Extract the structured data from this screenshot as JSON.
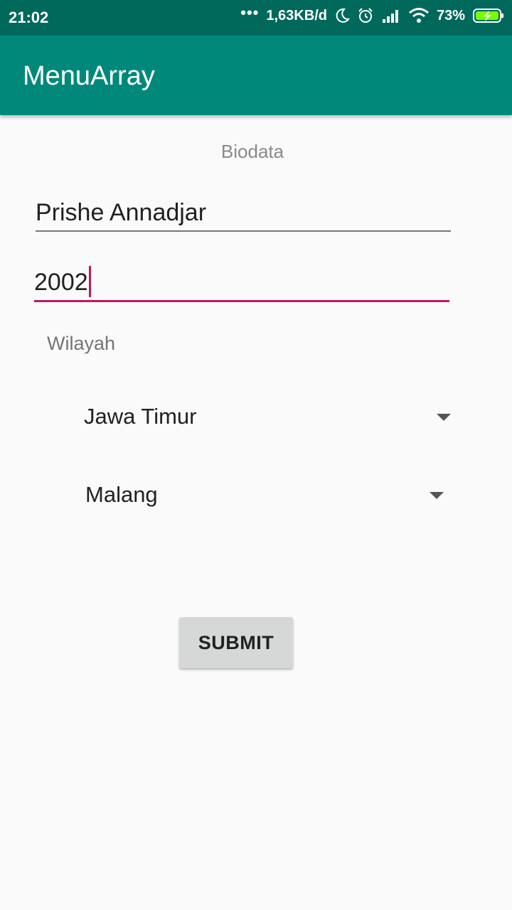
{
  "status_bar": {
    "time": "21:02",
    "network_speed": "1,63KB/d",
    "battery": "73%",
    "icons": [
      "more-dots-icon",
      "moon-icon",
      "alarm-icon",
      "signal-icon",
      "wifi-icon",
      "battery-charging-icon"
    ]
  },
  "app_bar": {
    "title": "MenuArray",
    "color": "#00897b"
  },
  "form": {
    "section_label": "Biodata",
    "name_value": "Prishe Annadjar",
    "year_value": "2002",
    "wilayah_label": "Wilayah",
    "province_selected": "Jawa Timur",
    "city_selected": "Malang",
    "submit_label": "SUBMIT",
    "accent_color": "#c2185b"
  }
}
